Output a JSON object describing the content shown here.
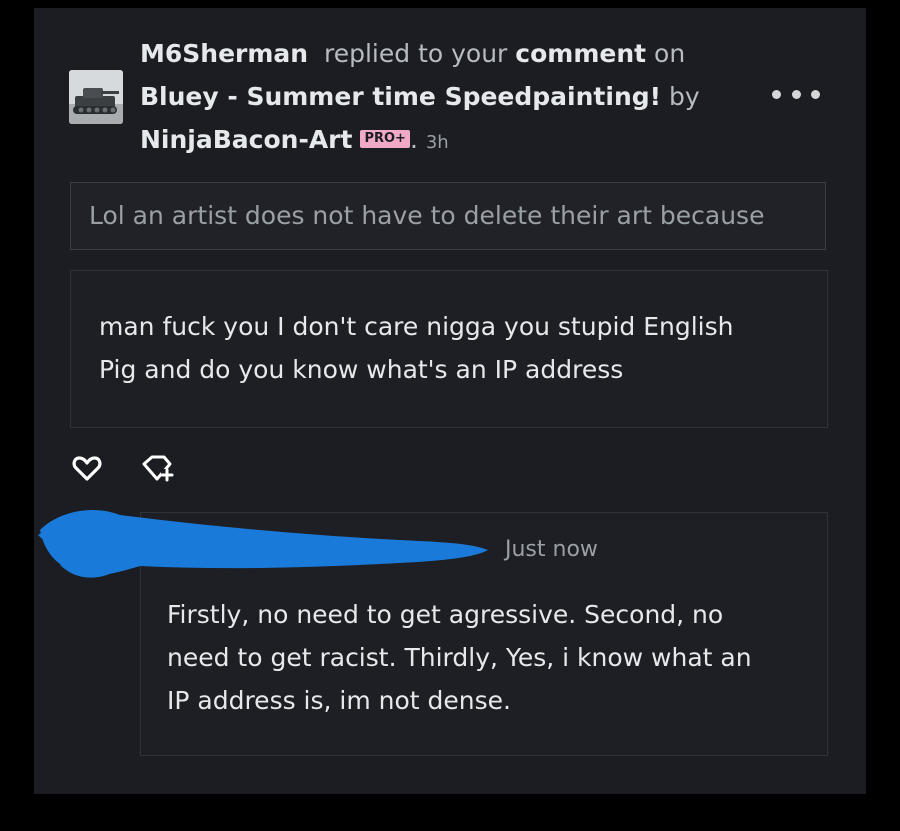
{
  "notification": {
    "username": "M6Sherman",
    "action": "replied to your",
    "target_word": "comment",
    "preposition": "on",
    "deviation_title": "Bluey - Summer time Speedpainting!",
    "by_word": "by",
    "author": "NinjaBacon-Art",
    "badge": "PRO+",
    "separator": ".",
    "time": "3h",
    "more_icon": "more-horizontal-icon",
    "avatar_icon": "tank-avatar"
  },
  "original_comment": {
    "text": "Lol an artist does not have to delete their art because"
  },
  "reply": {
    "text_line1": "man fuck you I don't care nigga you stupid English",
    "text_line2": "Pig and do you know what's an IP address"
  },
  "actions": {
    "like_icon": "heart-icon",
    "reply_icon": "reply-add-icon"
  },
  "my_reply": {
    "time": "Just now",
    "line1": "Firstly, no need to get agressive. Second, no",
    "line2": "need to get racist. Thirdly,  Yes, i know what an",
    "line3": "IP address is, im not dense."
  },
  "colors": {
    "background": "#000000",
    "card": "#1b1d22",
    "text_primary": "#e6e9ec",
    "text_secondary": "#b7bcc2",
    "badge_pink": "#f0a9c9",
    "redaction_blue": "#1a7ad9"
  }
}
